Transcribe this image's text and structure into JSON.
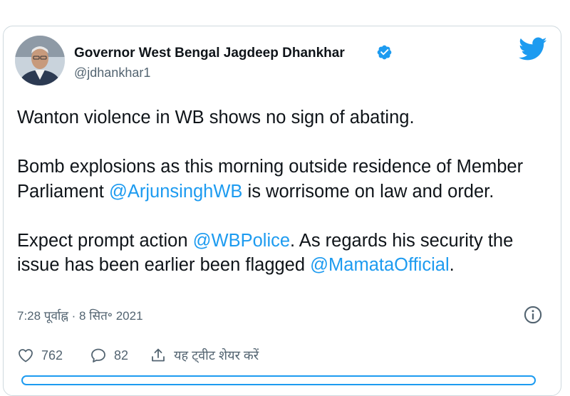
{
  "tweet": {
    "author": {
      "name": "Governor West Bengal Jagdeep Dhankhar",
      "handle": "@jdhankhar1",
      "verified_icon": "verified-badge-icon",
      "avatar_icon": "profile-photo"
    },
    "platform_icon": "twitter-bird-icon",
    "paragraphs": [
      [
        {
          "text": "Wanton violence in WB shows no sign of abating."
        }
      ],
      [
        {
          "text": "Bomb explosions as this morning outside residence of Member Parliament "
        },
        {
          "text": "@ArjunsinghWB",
          "mention": true
        },
        {
          "text": " is worrisome on law and order."
        }
      ],
      [
        {
          "text": "Expect prompt action "
        },
        {
          "text": "@WBPolice",
          "mention": true
        },
        {
          "text": ". As regards his security the issue has been earlier been flagged "
        },
        {
          "text": "@MamataOfficial",
          "mention": true
        },
        {
          "text": "."
        }
      ]
    ],
    "timestamp": "7:28 पूर्वाह्न · 8 सित॰ 2021",
    "info_icon": "info-icon",
    "actions": {
      "likes": "762",
      "replies": "82",
      "share_label": "यह ट्वीट शेयर करें"
    },
    "colors": {
      "accent": "#1d9bf0",
      "text": "#0f1419",
      "secondary": "#536471",
      "border": "#cfd9de"
    }
  }
}
